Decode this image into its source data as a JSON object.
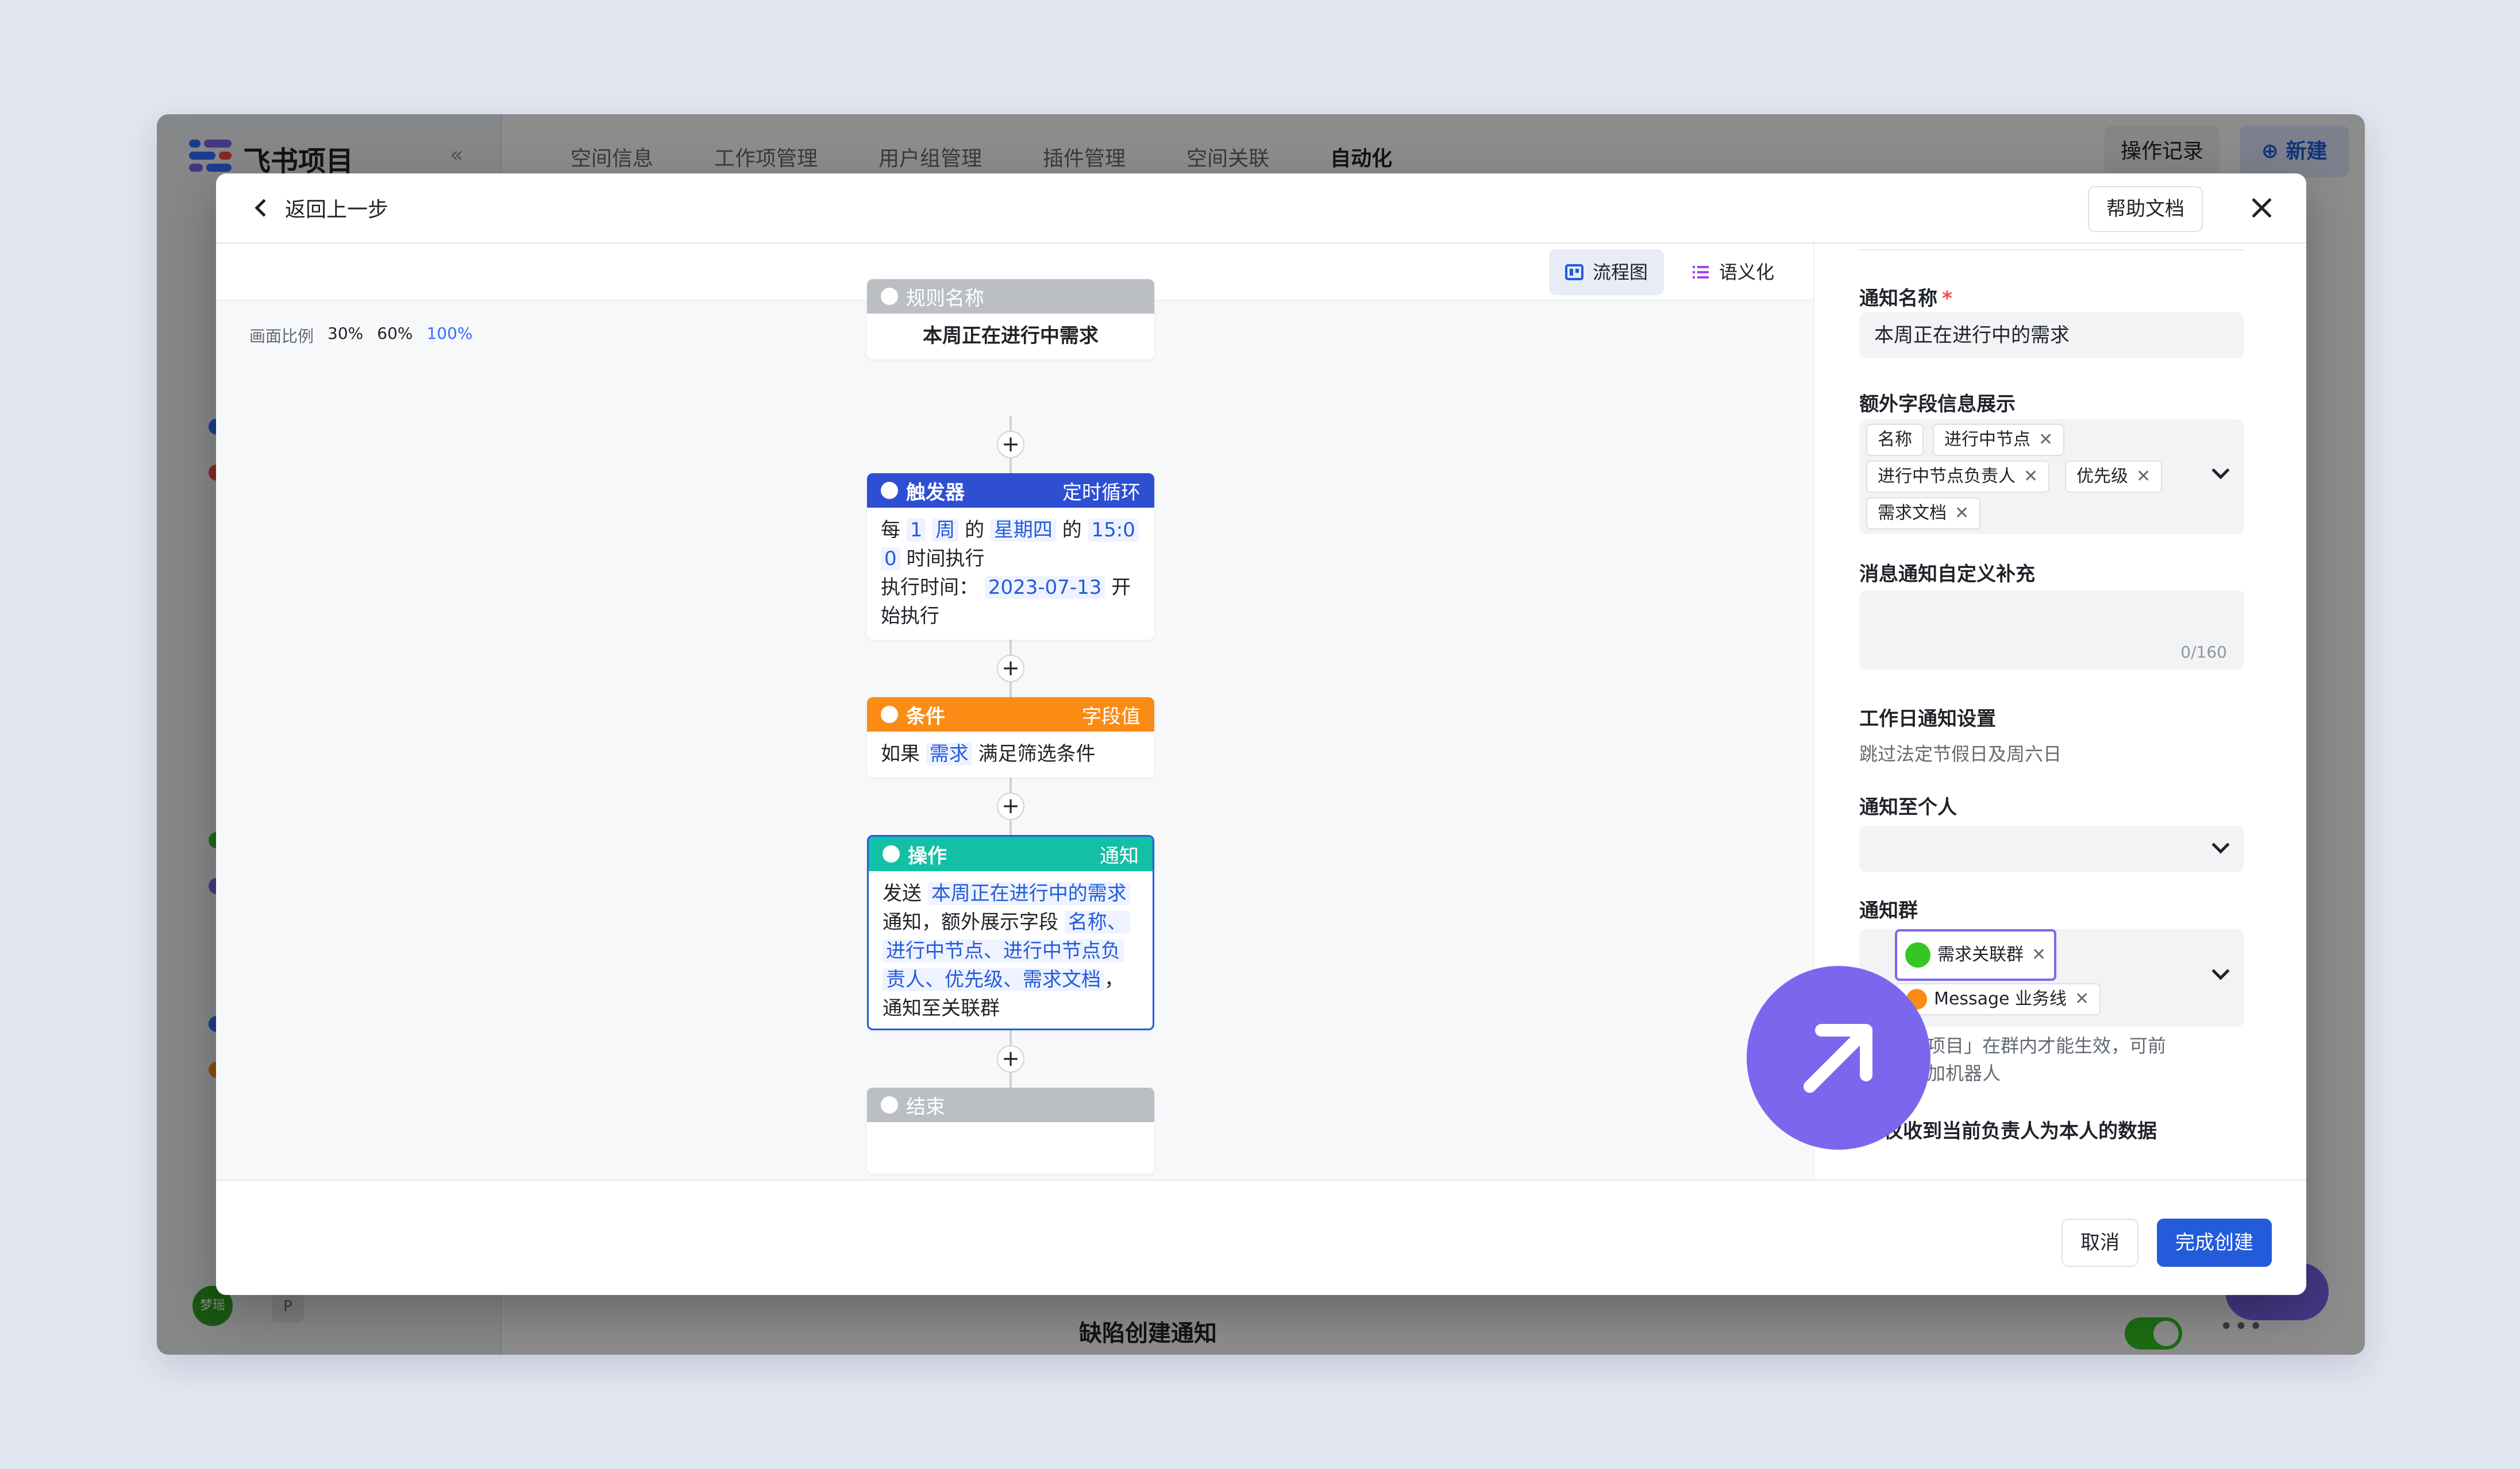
{
  "app": {
    "logo_text": "飞书项目",
    "collapse_glyph": "«",
    "nav": [
      "空间信息",
      "工作项管理",
      "用户组管理",
      "插件管理",
      "空间关联",
      "自动化"
    ],
    "nav_active": "自动化",
    "log_button": "操作记录",
    "new_button": "新建",
    "bottom_rule_title": "缺陷创建通知",
    "avatar_text": "梦瑶",
    "avatar_p": "P"
  },
  "modal": {
    "back_label": "返回上一步",
    "help_label": "帮助文档",
    "view_flow_label": "流程图",
    "view_semantic_label": "语义化",
    "zoom_label": "画面比例",
    "zoom_options": [
      "30%",
      "60%",
      "100%"
    ],
    "flow": {
      "rule": {
        "header": "规则名称",
        "body": "本周正在进行中需求"
      },
      "trigger": {
        "header": "触发器",
        "tag": "定时循环",
        "t1": "每",
        "v1": "1",
        "v2": "周",
        "t2": "的",
        "v3": "星期四",
        "t3": "的",
        "v4": "15:0",
        "v5": "0",
        "t4": "时间执行",
        "t5": "执行时间：",
        "v6": "2023-07-13",
        "t6": "开",
        "t7": "始执行"
      },
      "condition": {
        "header": "条件",
        "tag": "字段值",
        "t1": "如果",
        "v1": "需求",
        "t2": "满足筛选条件"
      },
      "action": {
        "header": "操作",
        "tag": "通知",
        "t1": "发送",
        "v1": "本周正在进行中的需求",
        "t2": "通知，额外展示字段",
        "v2": "名称、",
        "v3": "进行中节点、进行中节点负",
        "v4": "责人、优先级、需求文档",
        "t3": "，",
        "t4": "通知至关联群"
      },
      "end": {
        "header": "结束"
      },
      "plus": "+"
    },
    "form": {
      "name_label": "通知名称",
      "required_mark": "*",
      "name_value": "本周正在进行中的需求",
      "extra_label": "额外字段信息展示",
      "extra_tags": [
        "名称",
        "进行中节点",
        "进行中节点负责人",
        "优先级",
        "需求文档"
      ],
      "remove_glyph": "✕",
      "custom_label": "消息通知自定义补充",
      "counter": "0/160",
      "workday_label": "工作日通知设置",
      "workday_sub": "跳过法定节假日及周六日",
      "person_label": "通知至个人",
      "group_label": "通知群",
      "group_tags": [
        "需求关联群",
        "Message 业务线"
      ],
      "group_hint_1": "「飞书项目」在群内才能生效，可前",
      "group_hint_2": "群聊添加机器人",
      "self_label": "仅收到当前负责人为本人的数据"
    },
    "cancel_label": "取消",
    "done_label": "完成创建"
  },
  "colors": {
    "primary": "#245bdb",
    "trigger": "#2e4fd1",
    "condition": "#fa8c16",
    "action": "#14c0a5",
    "neutral_header": "#bbbfc4",
    "cursor": "#7b67ee"
  },
  "icons": [
    "logo-icon",
    "chevron-left-icon",
    "close-icon",
    "flowchart-icon",
    "list-icon",
    "play-icon",
    "trigger-icon",
    "filter-icon",
    "action-icon",
    "end-icon",
    "chevron-down-icon",
    "group-icon",
    "arrow-up-right-icon",
    "plus-circle-icon"
  ]
}
